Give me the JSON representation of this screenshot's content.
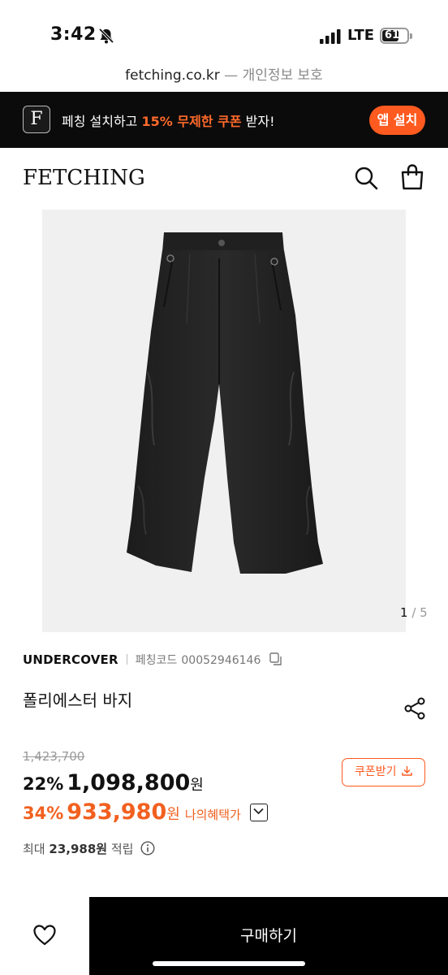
{
  "status_bar": {
    "time": "3:42",
    "network": "LTE",
    "battery_level": "61",
    "battery_fraction": 0.61,
    "icons": [
      "bell-slash-icon",
      "signal-icon",
      "battery-icon"
    ]
  },
  "browser": {
    "host": "fetching.co.kr",
    "separator": " — ",
    "privacy_label": "개인정보 보호"
  },
  "app_banner": {
    "logo_letter": "F",
    "text_before": "페칭 설치하고 ",
    "highlight": "15% 무제한 쿠폰",
    "text_after": " 받자!",
    "install_label": "앱 설치",
    "accent_color": "#ff5a1f"
  },
  "header": {
    "logo": "FETCHING",
    "icons": [
      "search-icon",
      "shopping-bag-icon"
    ]
  },
  "gallery": {
    "current": "1",
    "separator": " / ",
    "total": "5"
  },
  "product": {
    "brand": "UNDERCOVER",
    "code_label": "페칭코드",
    "code_value": "00052946146",
    "title": "폴리에스터 바지"
  },
  "pricing": {
    "original_price": "1,423,700",
    "discount_rate": "22%",
    "sale_price": "1,098,800",
    "currency": "원",
    "coupon_label": "쿠폰받기",
    "benefit_rate": "34%",
    "benefit_price": "933,980",
    "benefit_label": "나의혜택가",
    "accent_color": "#f2601f"
  },
  "points": {
    "prefix": "최대",
    "amount": "23,988원",
    "suffix": "적립"
  },
  "bottom_bar": {
    "buy_label": "구매하기"
  }
}
